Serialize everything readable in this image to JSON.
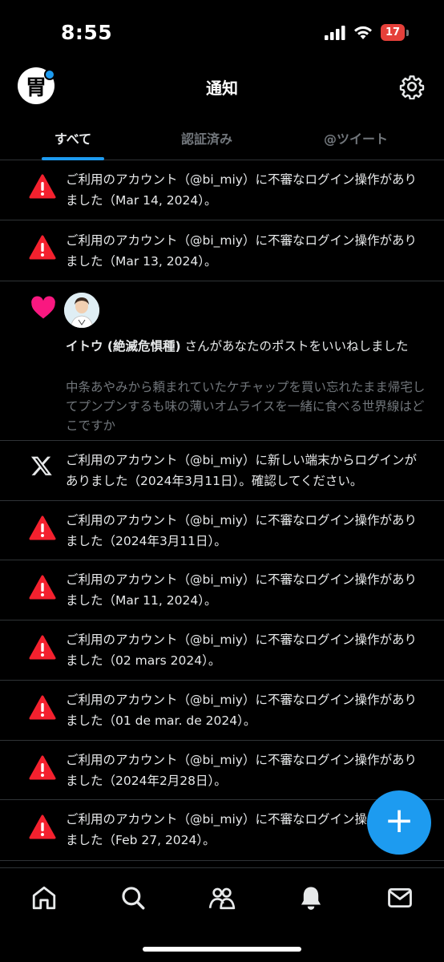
{
  "status_bar": {
    "time": "8:55",
    "battery": "17"
  },
  "header": {
    "title": "通知",
    "avatar_glyph": "胃"
  },
  "tabs": [
    {
      "label": "すべて",
      "active": true
    },
    {
      "label": "認証済み",
      "active": false
    },
    {
      "label": "@ツイート",
      "active": false
    }
  ],
  "notifications": [
    {
      "type": "alert",
      "text": "ご利用のアカウント（@bi_miy）に不審なログイン操作がありました（Mar 14, 2024）。"
    },
    {
      "type": "alert",
      "text": "ご利用のアカウント（@bi_miy）に不審なログイン操作がありました（Mar 13, 2024）。"
    },
    {
      "type": "like",
      "user": "イトウ (絶滅危惧種)",
      "action": " さんがあなたのポストをいいねしました",
      "quote": "中条あやみから頼まれていたケチャップを買い忘れたまま帰宅してプンプンするも味の薄いオムライスを一緒に食べる世界線はどこですか"
    },
    {
      "type": "x",
      "text": "ご利用のアカウント（@bi_miy）に新しい端末からログインがありました（2024年3月11日）。確認してください。"
    },
    {
      "type": "alert",
      "text": "ご利用のアカウント（@bi_miy）に不審なログイン操作がありました（2024年3月11日）。"
    },
    {
      "type": "alert",
      "text": "ご利用のアカウント（@bi_miy）に不審なログイン操作がありました（Mar 11, 2024）。"
    },
    {
      "type": "alert",
      "text": "ご利用のアカウント（@bi_miy）に不審なログイン操作がありました（02 mars 2024）。"
    },
    {
      "type": "alert",
      "text": "ご利用のアカウント（@bi_miy）に不審なログイン操作がありました（01 de mar. de 2024）。"
    },
    {
      "type": "alert",
      "text": "ご利用のアカウント（@bi_miy）に不審なログイン操作がありました（2024年2月28日）。"
    },
    {
      "type": "alert",
      "text": "ご利用のアカウント（@bi_miy）に不審なログイン操作がありました（Feb 27, 2024）。"
    }
  ],
  "fab": {
    "label": "+"
  },
  "bottom_nav": [
    "home-icon",
    "search-icon",
    "communities-icon",
    "notifications-icon",
    "messages-icon"
  ],
  "colors": {
    "accent": "#1d9bf0",
    "alert": "#f4212e",
    "like": "#f91880",
    "background": "#000000"
  }
}
